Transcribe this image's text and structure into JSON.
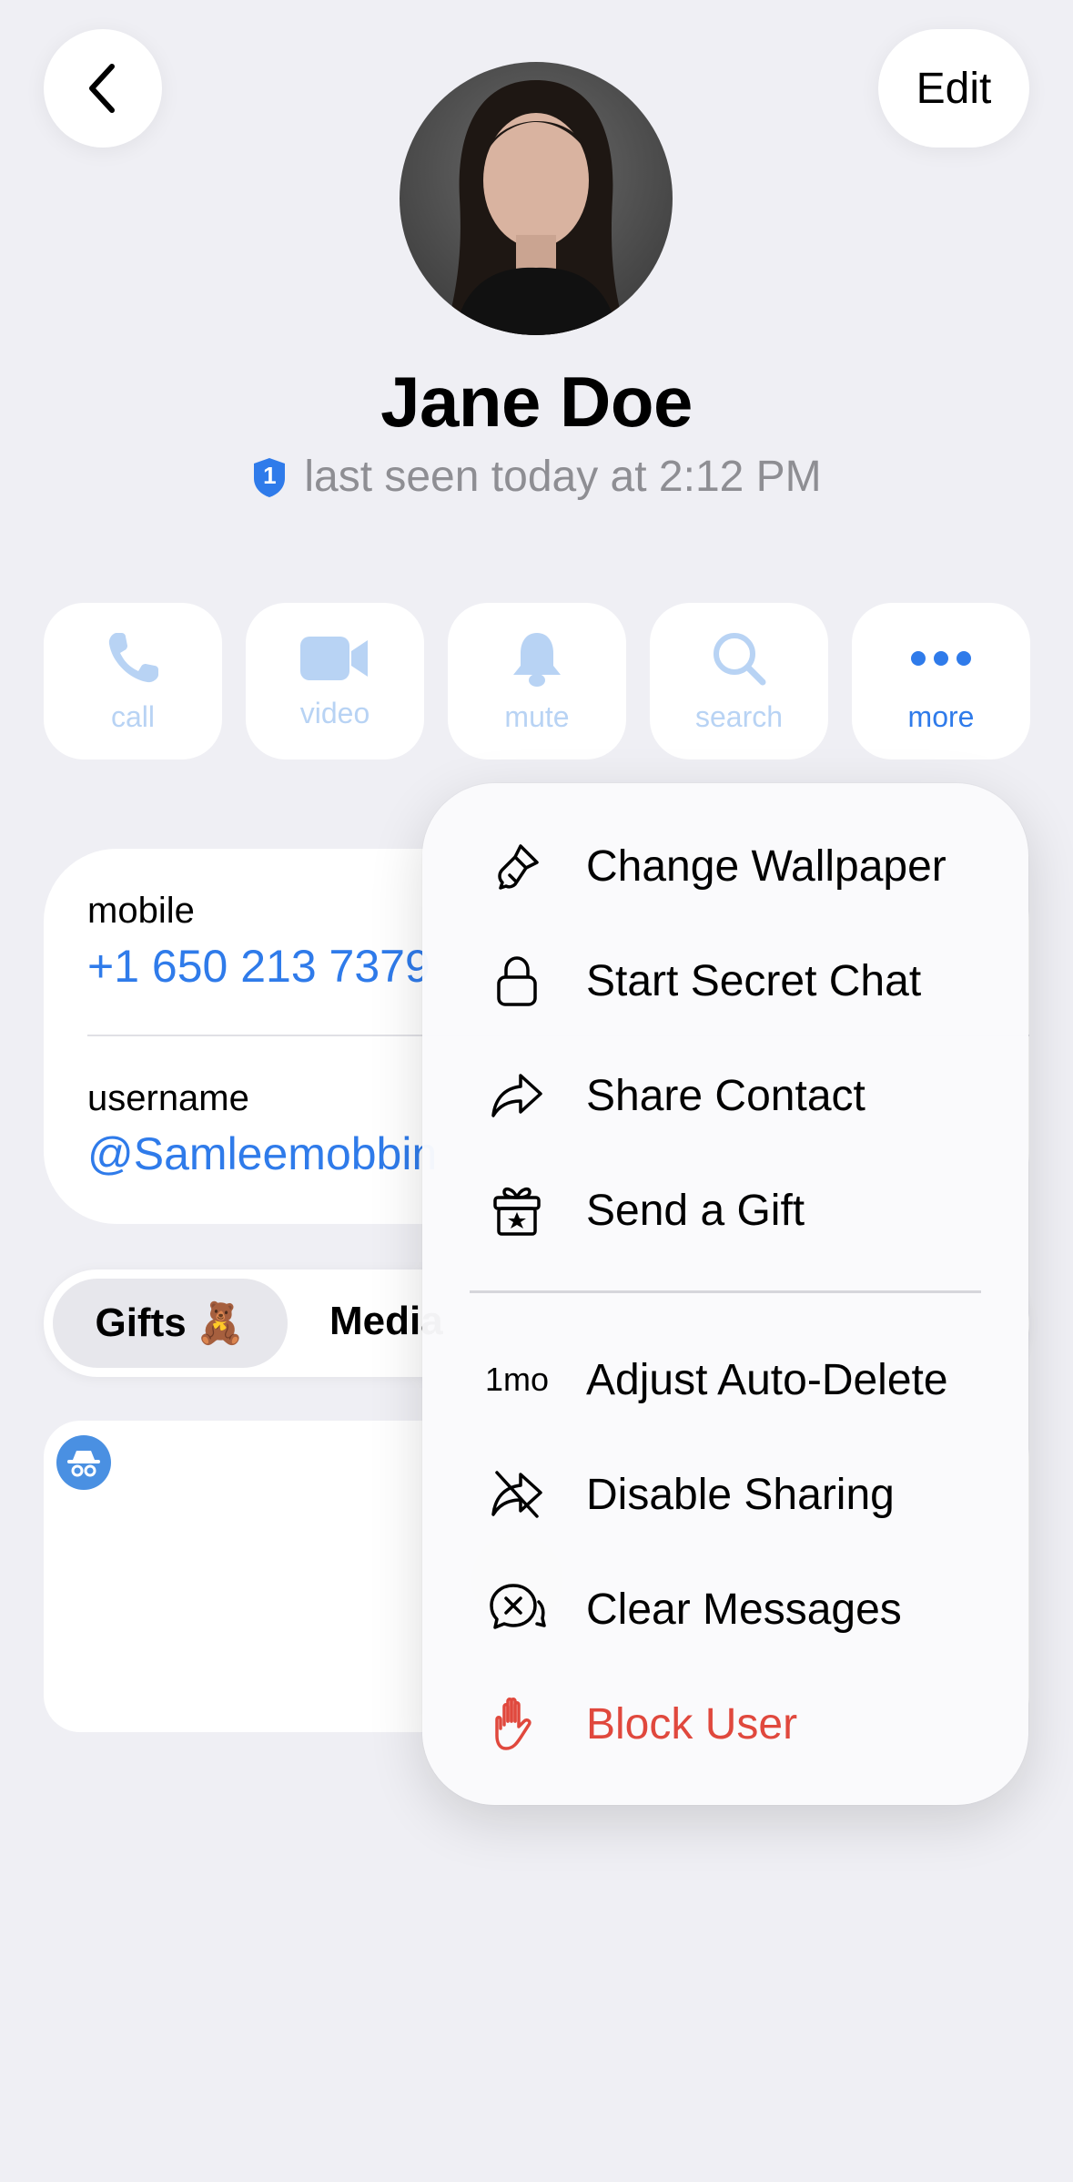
{
  "nav": {
    "edit_label": "Edit"
  },
  "profile": {
    "name": "Jane Doe",
    "badge_number": "1",
    "status": "last seen today at 2:12 PM"
  },
  "actions": [
    {
      "label": "call",
      "icon": "phone-icon"
    },
    {
      "label": "video",
      "icon": "video-camera-icon"
    },
    {
      "label": "mute",
      "icon": "bell-icon"
    },
    {
      "label": "search",
      "icon": "magnifier-icon"
    },
    {
      "label": "more",
      "icon": "ellipsis-icon"
    }
  ],
  "info": {
    "mobile_label": "mobile",
    "mobile_value": "+1 650 213 7379",
    "username_label": "username",
    "username_value": "@Samleemobbin"
  },
  "tabs": {
    "gifts_label": "Gifts",
    "gifts_emoji": "🧸",
    "media_label": "Media"
  },
  "menu": {
    "items": [
      {
        "label": "Change Wallpaper",
        "icon": "paintbrush-icon"
      },
      {
        "label": "Start Secret Chat",
        "icon": "lock-icon"
      },
      {
        "label": "Share Contact",
        "icon": "share-arrow-icon"
      },
      {
        "label": "Send a Gift",
        "icon": "gift-icon"
      },
      {
        "label": "Adjust Auto-Delete",
        "icon_text": "1mo"
      },
      {
        "label": "Disable Sharing",
        "icon": "share-disabled-icon"
      },
      {
        "label": "Clear Messages",
        "icon": "clear-chat-icon"
      },
      {
        "label": "Block User",
        "icon": "hand-icon"
      }
    ]
  },
  "colors": {
    "accent": "#2f7bea",
    "accent_faded": "#b8d3f4",
    "danger": "#e0483d",
    "background": "#efeff4"
  }
}
